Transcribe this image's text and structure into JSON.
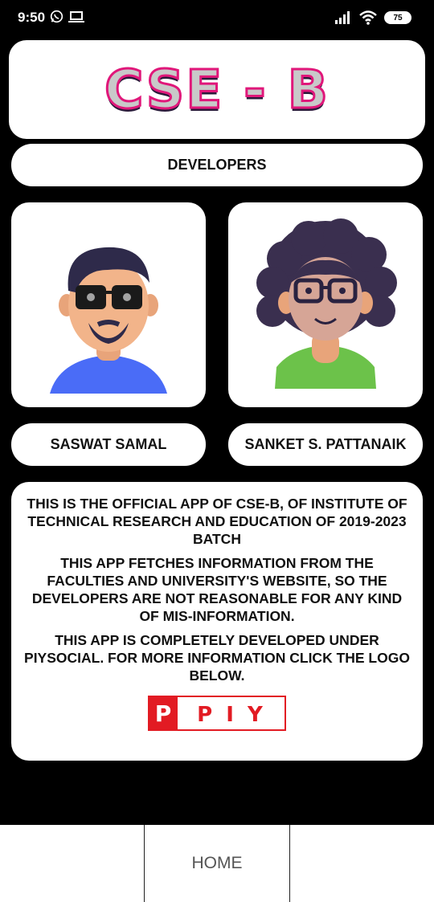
{
  "status_bar": {
    "time": "9:50",
    "battery": "75"
  },
  "header": {
    "logo_text": "CSE - B"
  },
  "developers_label": "DEVELOPERS",
  "developers": [
    {
      "name": "SASWAT SAMAL",
      "avatar": "male-avatar-sunglasses"
    },
    {
      "name": "SANKET S. PATTANAIK",
      "avatar": "curly-hair-avatar-glasses"
    }
  ],
  "info": {
    "paragraph1": "THIS IS THE OFFICIAL APP OF CSE-B, OF INSTITUTE OF TECHNICAL RESEARCH AND EDUCATION OF 2019-2023 BATCH",
    "paragraph2": "THIS APP FETCHES INFORMATION FROM THE FACULTIES AND UNIVERSITY'S WEBSITE, SO THE DEVELOPERS ARE NOT REASONABLE FOR ANY KIND OF MIS-INFORMATION.",
    "paragraph3": "THIS APP IS COMPLETELY DEVELOPED UNDER PIYSOCIAL. FOR MORE INFORMATION CLICK THE LOGO BELOW.",
    "logo_text": "P I Y"
  },
  "bottom_nav": {
    "home_label": "HOME"
  },
  "colors": {
    "background": "#000000",
    "card": "#ffffff",
    "logo_stroke": "#e0177a",
    "piy_red": "#e21b23"
  }
}
